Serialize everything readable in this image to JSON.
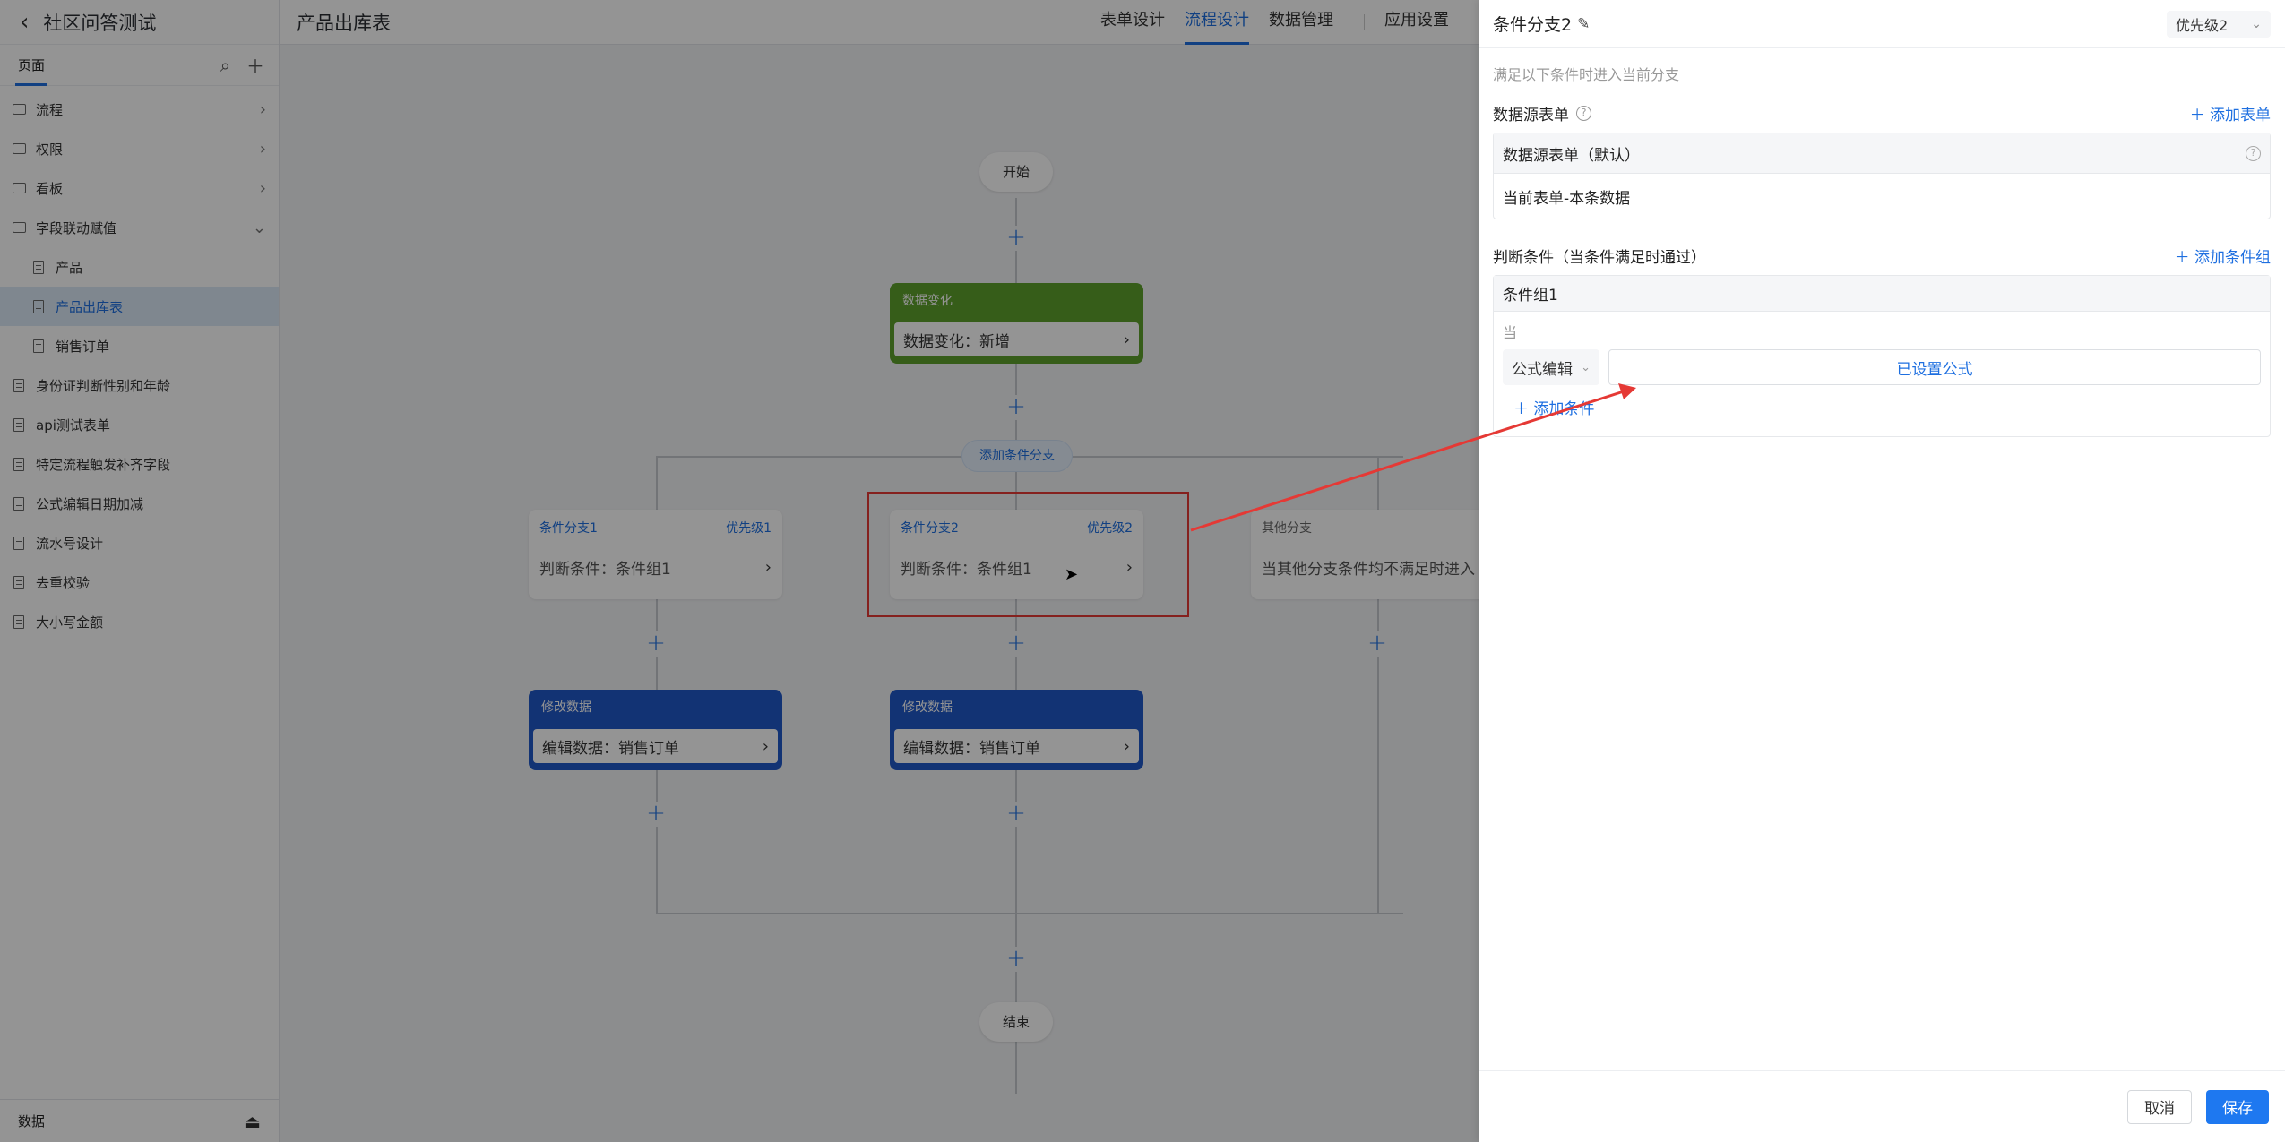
{
  "sidebar": {
    "app_title": "社区问答测试",
    "tab_label": "页面",
    "items": [
      {
        "label": "流程",
        "kind": "folder",
        "expanded": false
      },
      {
        "label": "权限",
        "kind": "folder",
        "expanded": false
      },
      {
        "label": "看板",
        "kind": "folder",
        "expanded": false
      },
      {
        "label": "字段联动赋值",
        "kind": "folder",
        "expanded": true
      },
      {
        "label": "产品",
        "kind": "doc",
        "child": true
      },
      {
        "label": "产品出库表",
        "kind": "doc",
        "child": true,
        "active": true
      },
      {
        "label": "销售订单",
        "kind": "doc",
        "child": true
      },
      {
        "label": "身份证判断性别和年龄",
        "kind": "doc"
      },
      {
        "label": "api测试表单",
        "kind": "doc"
      },
      {
        "label": "特定流程触发补齐字段",
        "kind": "doc"
      },
      {
        "label": "公式编辑日期加减",
        "kind": "doc"
      },
      {
        "label": "流水号设计",
        "kind": "doc"
      },
      {
        "label": "去重校验",
        "kind": "doc"
      },
      {
        "label": "大小写金额",
        "kind": "doc"
      }
    ],
    "footer_label": "数据"
  },
  "topbar": {
    "page_title": "产品出库表",
    "tabs": [
      {
        "label": "表单设计",
        "active": false
      },
      {
        "label": "流程设计",
        "active": true
      },
      {
        "label": "数据管理",
        "active": false
      }
    ],
    "settings_label": "应用设置"
  },
  "canvas": {
    "start_label": "开始",
    "end_label": "结束",
    "trigger_node": {
      "header": "数据变化",
      "body": "数据变化：新增"
    },
    "add_branch_label": "添加条件分支",
    "branches": [
      {
        "title": "条件分支1",
        "priority": "优先级1",
        "body": "判断条件：条件组1"
      },
      {
        "title": "条件分支2",
        "priority": "优先级2",
        "body": "判断条件：条件组1"
      },
      {
        "title": "其他分支",
        "priority": "",
        "body": "当其他分支条件均不满足时进入"
      }
    ],
    "modify_nodes": [
      {
        "header": "修改数据",
        "body": "编辑数据：销售订单"
      },
      {
        "header": "修改数据",
        "body": "编辑数据：销售订单"
      }
    ]
  },
  "panel": {
    "title": "条件分支2",
    "priority_value": "优先级2",
    "description": "满足以下条件时进入当前分支",
    "datasource_label": "数据源表单",
    "add_form_link": "添加表单",
    "datasource_box_title": "数据源表单（默认）",
    "datasource_box_value": "当前表单-本条数据",
    "condition_label": "判断条件（当条件满足时通过）",
    "add_group_link": "添加条件组",
    "group_title": "条件组1",
    "when_label": "当",
    "select_value": "公式编辑",
    "formula_value": "已设置公式",
    "add_condition_link": "添加条件",
    "cancel_label": "取消",
    "save_label": "保存"
  },
  "colors": {
    "accent": "#1e6fe0",
    "trigger_green": "#5da02c",
    "action_blue": "#2058c8",
    "annotation_red": "#e53935"
  }
}
